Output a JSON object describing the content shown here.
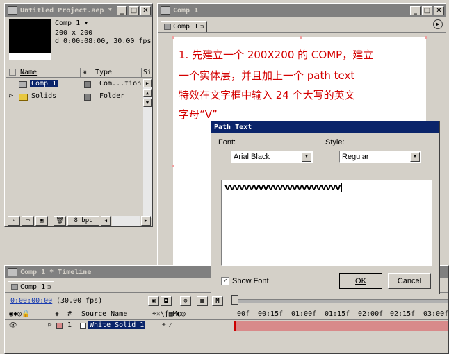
{
  "project": {
    "title": "Untitled Project.aep *",
    "comp_name": "Comp 1",
    "comp_size": "200 x 200",
    "comp_duration": "d 0:00:08:00, 30.00 fps",
    "col_name": "Name",
    "col_type": "Type",
    "col_size": "Si",
    "rows": [
      {
        "name": "Comp 1",
        "type": "Com...tion"
      },
      {
        "name": "Solids",
        "type": "Folder"
      }
    ],
    "bpc": "8 bpc"
  },
  "comp_window": {
    "title": "Comp 1",
    "tab": "Comp 1",
    "instructions": [
      "1. 先建立一个 200X200 的 COMP，建立",
      "一个实体层，并且加上一个 path text",
      "特效在文字框中输入 24 个大写的英文",
      "字母“V”"
    ]
  },
  "dialog": {
    "title": "Path Text",
    "font_label": "Font:",
    "font_value": "Arial Black",
    "style_label": "Style:",
    "style_value": "Regular",
    "text": "VVVVVVVVVVVVVVVVVVVVVVVV",
    "show_font_label": "Show Font",
    "ok_label": "OK",
    "cancel_label": "Cancel"
  },
  "timeline": {
    "title": "Comp 1 * Timeline",
    "tab": "Comp 1",
    "time": "0:00:00:00",
    "fps": "(30.00 fps)",
    "col_num": "#",
    "col_source": "Source Name",
    "layer_num": "1",
    "layer_name": "White Solid 1",
    "ruler": [
      "00f",
      "00:15f",
      "01:00f",
      "01:15f",
      "02:00f",
      "02:15f",
      "03:00f"
    ]
  },
  "colors": {
    "accent_red": "#d40000",
    "dialog_title": "#0a246a",
    "selection": "#0a246a",
    "solid_swatch": "#d88a8a"
  }
}
